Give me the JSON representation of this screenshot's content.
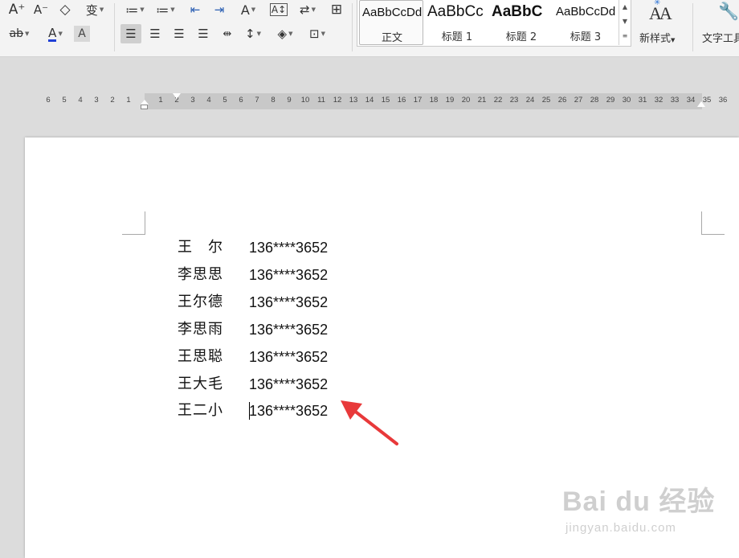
{
  "ribbon": {
    "font_tools": {
      "grow_font_icon": "A⁺",
      "shrink_font_icon": "A⁻",
      "clear_format_icon": "◇",
      "phonetic_icon": "变",
      "strike_icon": "ab",
      "font_color_icon": "A",
      "char_shading_icon": "A"
    },
    "paragraph_tools": {
      "bullets_icon": "≔",
      "numbering_icon": "≔",
      "decrease_indent_icon": "⇤",
      "increase_indent_icon": "⇥",
      "text_direction_icon": "A",
      "sort_icon": "A↕",
      "spacing_icon": "⇄",
      "borders_icon": "⊞"
    },
    "styles": [
      {
        "sample": "AaBbCcDd",
        "name": "正文",
        "selected": true
      },
      {
        "sample": "AaBbCc",
        "name": "标题 1",
        "selected": false
      },
      {
        "sample": "AaBbC",
        "name": "标题 2",
        "selected": false
      },
      {
        "sample": "AaBbCcDd",
        "name": "标题 3",
        "selected": false
      }
    ],
    "new_style_label": "新样式",
    "text_tools_label": "文字工具"
  },
  "ruler": {
    "left_numbers": [
      "6",
      "5",
      "4",
      "3",
      "2",
      "1"
    ],
    "right_numbers": [
      "1",
      "2",
      "3",
      "4",
      "5",
      "6",
      "7",
      "8",
      "9",
      "10",
      "11",
      "12",
      "13",
      "14",
      "15",
      "16",
      "17",
      "18",
      "19",
      "20",
      "21",
      "22",
      "23",
      "24",
      "25",
      "26",
      "27",
      "28",
      "29",
      "30",
      "31",
      "32",
      "33",
      "34",
      "35",
      "36"
    ]
  },
  "document": {
    "rows": [
      {
        "name": "王　尔",
        "phone": "136****3652"
      },
      {
        "name": "李思思",
        "phone": "136****3652"
      },
      {
        "name": "王尔德",
        "phone": "136****3652"
      },
      {
        "name": "李思雨",
        "phone": "136****3652"
      },
      {
        "name": "王思聪",
        "phone": "136****3652"
      },
      {
        "name": "王大毛",
        "phone": "136****3652"
      },
      {
        "name": "王二小",
        "phone": "136****3652"
      }
    ]
  },
  "annotation": {
    "arrow_color": "#e8393a"
  },
  "watermark": {
    "brand": "Bai du 经验",
    "url": "jingyan.baidu.com"
  }
}
